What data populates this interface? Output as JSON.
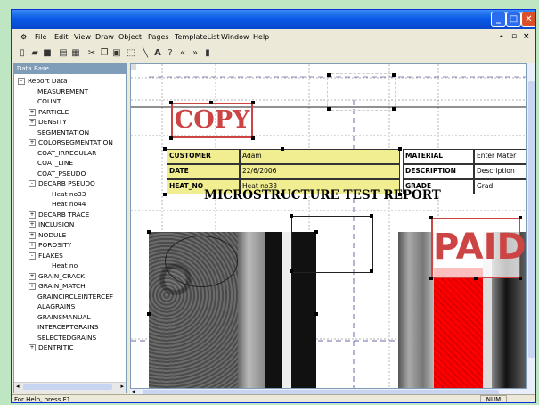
{
  "menu": [
    "File",
    "Edit",
    "View",
    "Draw",
    "Object",
    "Pages",
    "TemplateList",
    "Window",
    "Help"
  ],
  "panel_title": "Data Base",
  "tree": [
    {
      "label": "Report Data",
      "level": 0,
      "exp": "-"
    },
    {
      "label": "MEASUREMENT",
      "level": 1,
      "exp": ""
    },
    {
      "label": "COUNT",
      "level": 1,
      "exp": ""
    },
    {
      "label": "PARTICLE",
      "level": 1,
      "exp": "+"
    },
    {
      "label": "DENSITY",
      "level": 1,
      "exp": "+"
    },
    {
      "label": "SEGMENTATION",
      "level": 1,
      "exp": ""
    },
    {
      "label": "COLORSEGMENTATION",
      "level": 1,
      "exp": "+"
    },
    {
      "label": "COAT_IRREGULAR",
      "level": 1,
      "exp": ""
    },
    {
      "label": "COAT_LINE",
      "level": 1,
      "exp": ""
    },
    {
      "label": "COAT_PSEUDO",
      "level": 1,
      "exp": ""
    },
    {
      "label": "DECARB PSEUDO",
      "level": 1,
      "exp": "-"
    },
    {
      "label": "Heat no33",
      "level": 2,
      "exp": ""
    },
    {
      "label": "Heat no44",
      "level": 2,
      "exp": ""
    },
    {
      "label": "DECARB TRACE",
      "level": 1,
      "exp": "+"
    },
    {
      "label": "INCLUSION",
      "level": 1,
      "exp": "+"
    },
    {
      "label": "NODULE",
      "level": 1,
      "exp": "+"
    },
    {
      "label": "POROSITY",
      "level": 1,
      "exp": "+"
    },
    {
      "label": "FLAKES",
      "level": 1,
      "exp": "-"
    },
    {
      "label": "Heat no",
      "level": 2,
      "exp": ""
    },
    {
      "label": "GRAIN_CRACK",
      "level": 1,
      "exp": "+"
    },
    {
      "label": "GRAIN_MATCH",
      "level": 1,
      "exp": "+"
    },
    {
      "label": "GRAINCIRCLEINTERCEF",
      "level": 1,
      "exp": ""
    },
    {
      "label": "ALAGRAINS",
      "level": 1,
      "exp": ""
    },
    {
      "label": "GRAINSMANUAL",
      "level": 1,
      "exp": ""
    },
    {
      "label": "INTERCEPTGRAINS",
      "level": 1,
      "exp": ""
    },
    {
      "label": "SELECTEDGRAINS",
      "level": 1,
      "exp": ""
    },
    {
      "label": "DENTRITIC",
      "level": 1,
      "exp": "+"
    }
  ],
  "report": {
    "copy_stamp": "COPY",
    "paid_stamp": "PAID",
    "title": "MICROSTRUCTURE TEST REPORT",
    "rows": [
      {
        "label": "CUSTOMER",
        "value": "Adam",
        "label2": "MATERIAL",
        "value2": "Enter Mater"
      },
      {
        "label": "DATE",
        "value": "22/6/2006",
        "label2": "DESCRIPTION",
        "value2": "Description"
      },
      {
        "label": "HEAT_NO",
        "value": "Heat no33",
        "label2": "GRADE",
        "value2": "Grad"
      }
    ]
  },
  "status": {
    "help": "For Help, press F1",
    "num": "NUM"
  },
  "colors": {
    "titlebar": "#0a5ae8",
    "table_fill": "#f0ee90",
    "stamp": "#cc4444"
  }
}
